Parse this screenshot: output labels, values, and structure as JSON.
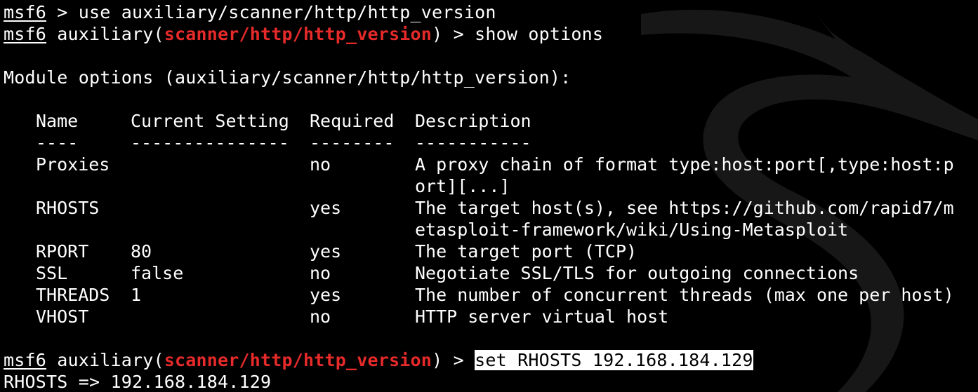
{
  "terminal": {
    "prompt_word": "msf6",
    "line1_command": " > use auxiliary/scanner/http/http_version",
    "module_prefix": " auxiliary(",
    "module_name": "scanner/http/http_version",
    "module_suffix": ") > ",
    "line2_command": "show options",
    "module_options_heading": "Module options (auxiliary/scanner/http/http_version):",
    "table": {
      "headers": [
        "Name",
        "Current Setting",
        "Required",
        "Description"
      ],
      "separators": [
        "----",
        "---------------",
        "--------",
        "-----------"
      ],
      "rows": [
        {
          "name": "Proxies",
          "setting": "",
          "required": "no",
          "desc": [
            "A proxy chain of format type:host:port[,type:host:p",
            "ort][...]"
          ]
        },
        {
          "name": "RHOSTS",
          "setting": "",
          "required": "yes",
          "desc": [
            "The target host(s), see https://github.com/rapid7/m",
            "etasploit-framework/wiki/Using-Metasploit"
          ]
        },
        {
          "name": "RPORT",
          "setting": "80",
          "required": "yes",
          "desc": [
            "The target port (TCP)"
          ]
        },
        {
          "name": "SSL",
          "setting": "false",
          "required": "no",
          "desc": [
            "Negotiate SSL/TLS for outgoing connections"
          ]
        },
        {
          "name": "THREADS",
          "setting": "1",
          "required": "yes",
          "desc": [
            "The number of concurrent threads (max one per host)"
          ]
        },
        {
          "name": "VHOST",
          "setting": "",
          "required": "no",
          "desc": [
            "HTTP server virtual host"
          ]
        }
      ]
    },
    "set_command": "set RHOSTS 192.168.184.129",
    "output_line": "RHOSTS => 192.168.184.129"
  },
  "colors": {
    "background": "#000000",
    "text": "#ffffff",
    "module_highlight": "#e62a2a"
  },
  "icons": {
    "watermark": "kali-dragon-icon"
  }
}
